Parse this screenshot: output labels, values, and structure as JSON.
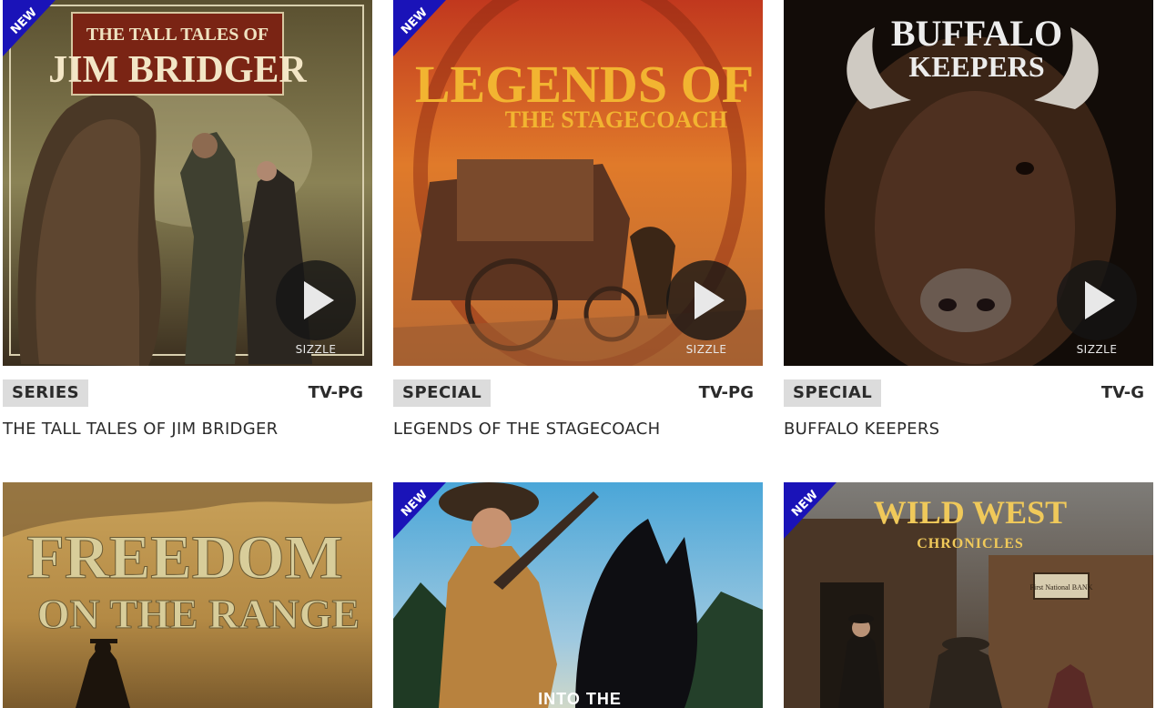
{
  "cards": [
    {
      "title": "THE TALL TALES OF JIM BRIDGER",
      "type": "SERIES",
      "rating": "TV-PG",
      "new": "NEW",
      "video_label": "SIZZLE",
      "art_title_1": "THE TALL TALES OF",
      "art_title_2": "JIM BRIDGER",
      "accent": "#7a2414"
    },
    {
      "title": "LEGENDS OF THE STAGECOACH",
      "type": "SPECIAL",
      "rating": "TV-PG",
      "new": "NEW",
      "video_label": "SIZZLE",
      "art_title_1": "LEGENDS OF",
      "art_title_2": "THE STAGECOACH",
      "accent": "#f0b233"
    },
    {
      "title": "BUFFALO KEEPERS",
      "type": "SPECIAL",
      "rating": "TV-G",
      "video_label": "SIZZLE",
      "art_title_1": "BUFFALO",
      "art_title_2": "KEEPERS",
      "accent": "#e6e6e6"
    },
    {
      "art_title_1": "FREEDOM",
      "art_title_2": "ON THE RANGE",
      "accent": "#d8cd9a"
    },
    {
      "new": "NEW",
      "art_title_1": "INTO THE",
      "accent": "#ffffff"
    },
    {
      "new": "NEW",
      "art_title_1": "WILD WEST",
      "art_title_2": "CHRONICLES",
      "art_sign": "First National BANK",
      "accent": "#f0c95a"
    }
  ],
  "colors": {
    "new_badge": "#1a13b8",
    "meta_badge_bg": "#dcdcdc",
    "text": "#2b2b2b"
  }
}
